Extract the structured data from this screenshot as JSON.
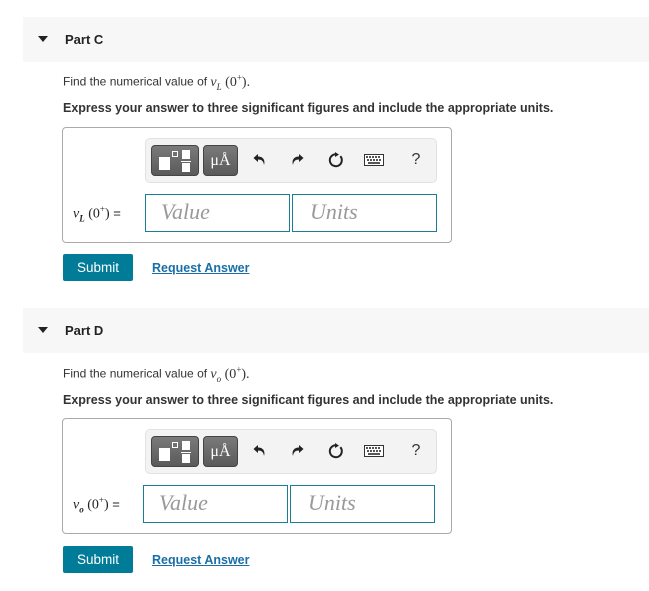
{
  "parts": [
    {
      "title": "Part C",
      "prompt_text": "Find the numerical value of ",
      "prompt_var": "v",
      "prompt_sub": "L",
      "prompt_arg_open": "(0",
      "prompt_arg_sup": "+",
      "prompt_arg_close": ").",
      "instruction": "Express your answer to three significant figures and include the appropriate units.",
      "toolbar": {
        "templates_icon": "templates-icon",
        "units_label": "μÅ",
        "undo_icon": "undo-icon",
        "redo_icon": "redo-icon",
        "reset_icon": "reset-icon",
        "keyboard_icon": "keyboard-icon",
        "help_label": "?"
      },
      "eq_var": "v",
      "eq_sub": "L",
      "eq_arg_open": "(0",
      "eq_arg_sup": "+",
      "eq_arg_close": ")",
      "eq_sign": " =",
      "value_placeholder": "Value",
      "units_placeholder": "Units",
      "submit_label": "Submit",
      "request_label": "Request Answer"
    },
    {
      "title": "Part D",
      "prompt_text": "Find the numerical value of ",
      "prompt_var": "v",
      "prompt_sub": "o",
      "prompt_arg_open": "(0",
      "prompt_arg_sup": "+",
      "prompt_arg_close": ").",
      "instruction": "Express your answer to three significant figures and include the appropriate units.",
      "toolbar": {
        "templates_icon": "templates-icon",
        "units_label": "μÅ",
        "undo_icon": "undo-icon",
        "redo_icon": "redo-icon",
        "reset_icon": "reset-icon",
        "keyboard_icon": "keyboard-icon",
        "help_label": "?"
      },
      "eq_var": "v",
      "eq_sub": "o",
      "eq_arg_open": "(0",
      "eq_arg_sup": "+",
      "eq_arg_close": ")",
      "eq_sign": " =",
      "value_placeholder": "Value",
      "units_placeholder": "Units",
      "submit_label": "Submit",
      "request_label": "Request Answer"
    }
  ],
  "colors": {
    "header_bg": "#f7f7f7",
    "submit_bg": "#007c99",
    "input_border": "#1a7f96",
    "link": "#1a6ea8"
  }
}
